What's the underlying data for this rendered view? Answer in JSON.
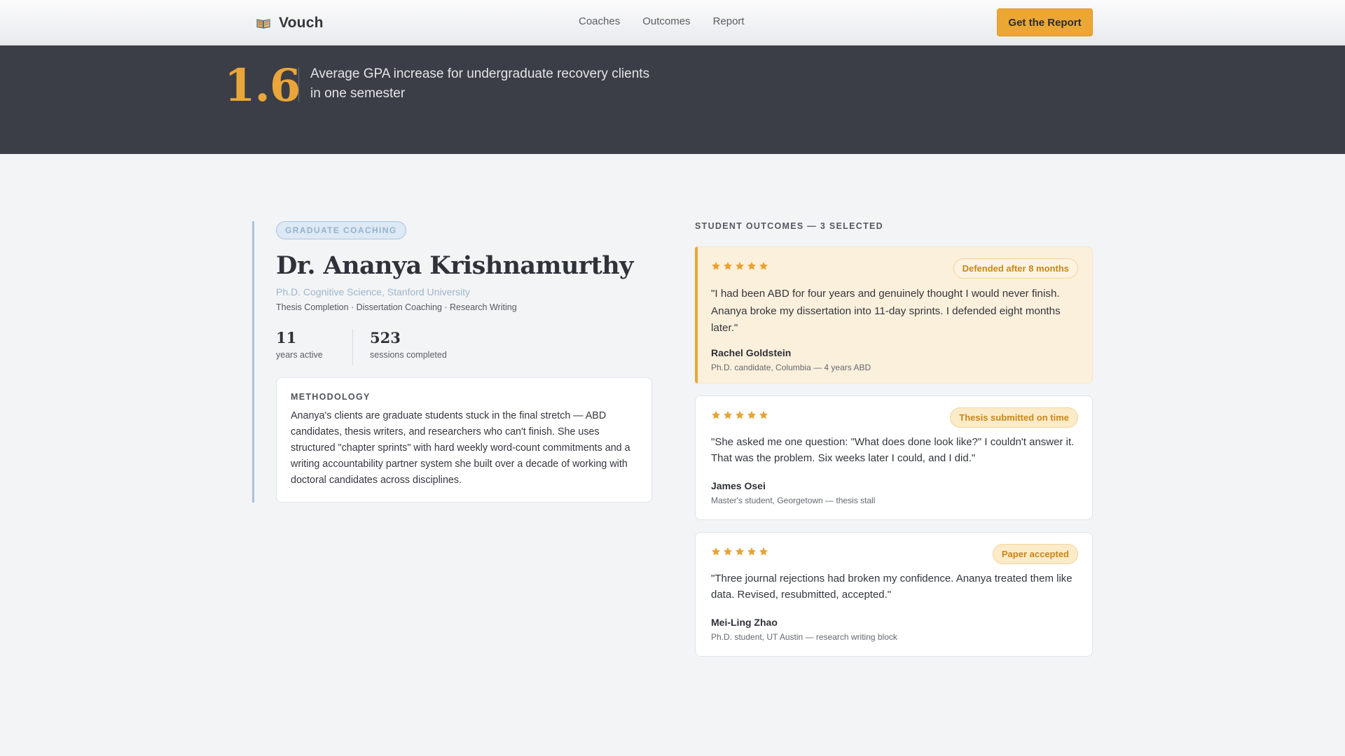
{
  "nav": {
    "brand": "Vouch",
    "brand_icon": "open-book-icon",
    "links": [
      "Coaches",
      "Outcomes",
      "Report"
    ],
    "cta": "Get the Report"
  },
  "hero": {
    "value": "1.6",
    "caption": "Average GPA increase for undergraduate recovery clients in one semester"
  },
  "profile": {
    "badge": "GRADUATE COACHING",
    "name": "Dr. Ananya Krishnamurthy",
    "credential": "Ph.D. Cognitive Science, Stanford University",
    "specialties": "Thesis Completion · Dissertation Coaching · Research Writing",
    "stats": [
      {
        "value": "11",
        "label": "years active"
      },
      {
        "value": "523",
        "label": "sessions completed"
      }
    ],
    "methodology": {
      "title": "METHODOLOGY",
      "body": "Ananya's clients are graduate students stuck in the final stretch — ABD candidates, thesis writers, and researchers who can't finish. She uses structured \"chapter sprints\" with hard weekly word-count commitments and a writing accountability partner system she built over a decade of working with doctoral candidates across disciplines."
    }
  },
  "outcomes": {
    "heading": "STUDENT OUTCOMES — 3 SELECTED",
    "star_color": "#eaa235",
    "testimonials": [
      {
        "rating": 5,
        "badge": "Defended after 8 months",
        "quote": "\"I had been ABD for four years and genuinely thought I would never finish. Ananya broke my dissertation into 11-day sprints. I defended eight months later.\"",
        "author": "Rachel Goldstein",
        "meta": "Ph.D. candidate, Columbia — 4 years ABD"
      },
      {
        "rating": 5,
        "badge": "Thesis submitted on time",
        "quote": "\"She asked me one question: \"What does done look like?\" I couldn't answer it. That was the problem. Six weeks later I could, and I did.\"",
        "author": "James Osei",
        "meta": "Master's student, Georgetown — thesis stall"
      },
      {
        "rating": 5,
        "badge": "Paper accepted",
        "quote": "\"Three journal rejections had broken my confidence. Ananya treated them like data. Revised, resubmitted, accepted.\"",
        "author": "Mei-Ling Zhao",
        "meta": "Ph.D. student, UT Austin — research writing block"
      }
    ]
  },
  "colors": {
    "accent": "#eca634",
    "hero_bg": "#3b3e46",
    "profile_rule": "#a9c3db"
  }
}
